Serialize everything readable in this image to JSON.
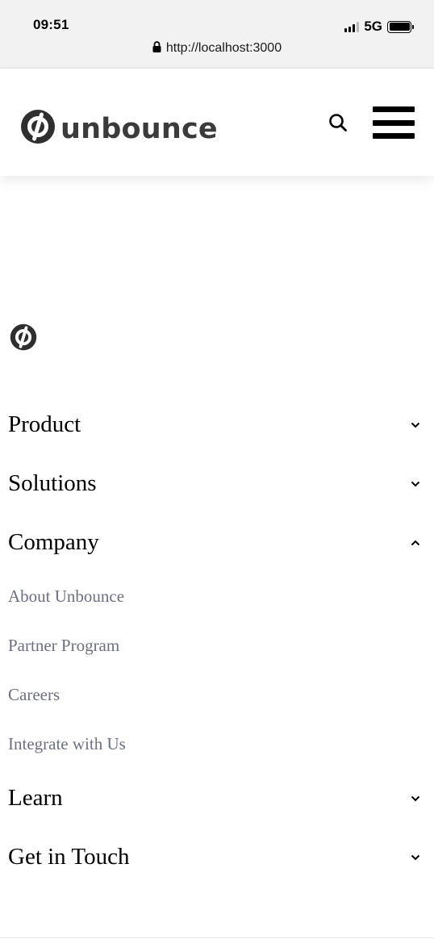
{
  "status": {
    "time": "09:51",
    "network": "5G"
  },
  "browser": {
    "url": "http://localhost:3000"
  },
  "header": {
    "brand": "unbounce"
  },
  "footer": {
    "sections": [
      {
        "label": "Product",
        "expanded": false
      },
      {
        "label": "Solutions",
        "expanded": false
      },
      {
        "label": "Company",
        "expanded": true,
        "items": [
          "About Unbounce",
          "Partner Program",
          "Careers",
          "Integrate with Us"
        ]
      },
      {
        "label": "Learn",
        "expanded": false
      },
      {
        "label": "Get in Touch",
        "expanded": false
      }
    ]
  },
  "colors": {
    "submenu_text": "#6b7180",
    "brand_text": "#3b3b3b"
  },
  "icons": {
    "search": "search-icon",
    "menu": "hamburger-menu-icon",
    "chevron_down": "chevron-down-icon",
    "chevron_up": "chevron-up-icon",
    "logo": "unbounce-logo-icon",
    "lock": "lock-icon"
  }
}
